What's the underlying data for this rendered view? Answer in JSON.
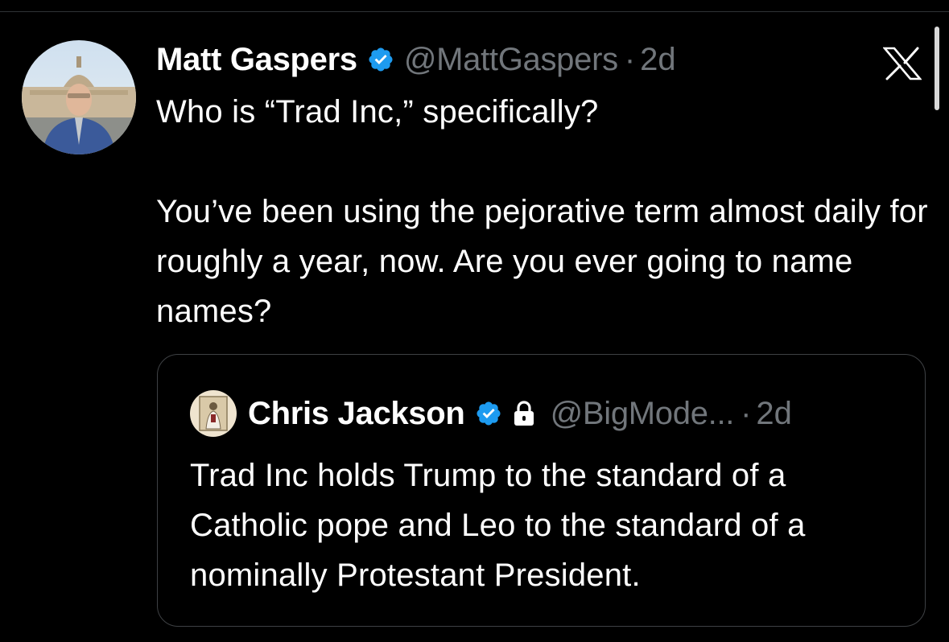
{
  "tweet": {
    "display_name": "Matt Gaspers",
    "handle": "@MattGaspers",
    "separator": "·",
    "time": "2d",
    "body_paragraph_1": "Who is “Trad Inc,” specifically?",
    "body_paragraph_2": "You’ve been using the pejorative term almost daily for roughly a year, now. Are you ever going to name names?"
  },
  "quoted_tweet": {
    "display_name": "Chris Jackson",
    "handle": "@BigMode...",
    "separator": "·",
    "time": "2d",
    "body": "Trad Inc holds Trump to the standard of a Catholic pope and Leo to the standard of a nominally Protestant President."
  },
  "icons": {
    "verified": "verified-badge-icon",
    "protected": "lock-icon",
    "brand": "x-logo-icon"
  },
  "colors": {
    "background": "#000000",
    "text_primary": "#ffffff",
    "text_secondary": "#71767b",
    "verified_blue": "#1d9bf0",
    "card_border": "#3e4144"
  }
}
